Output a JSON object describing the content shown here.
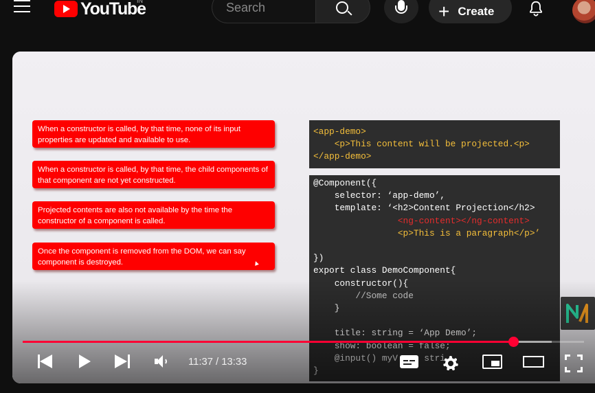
{
  "header": {
    "logo_text": "YouTube",
    "region": "IN",
    "search_placeholder": "Search",
    "create_label": "Create",
    "icons": [
      "menu-icon",
      "search-icon",
      "mic-icon",
      "plus-icon",
      "bell-icon"
    ]
  },
  "slide": {
    "cards": [
      "When a constructor is called, by that time, none of its input properties are updated and available to use.",
      "When a constructor is called, by that time, the child components of that component are not yet constructed.",
      "Projected contents are also not available by the time the constructor of a component is called.",
      "Once the component is removed from the DOM, we can say component is destroyed."
    ],
    "code_top": [
      "<app-demo>",
      "    <p>This content will be projected.<p>",
      "</app-demo>"
    ],
    "code_bottom": [
      "@Component({",
      "    selector: ‘app-demo’,",
      "    template: ‘<h2>Content Projection</h2>",
      "                <ng-content></ng-content>",
      "                <p>This is a paragraph</p>’",
      "",
      "})",
      "export class DemoComponent{",
      "    constructor(){",
      "        //Some code",
      "    }",
      "",
      "    title: string = ‘App Demo’;",
      "    show: boolean = false;",
      "    @input() myV     stri",
      "}"
    ],
    "colors": {
      "card_red": "#fe0000",
      "code_bg": "#2d2d2d",
      "tag_yellow": "#f5bf3a",
      "keyword_red": "#e52d2d",
      "type_blue": "#8fb7ff"
    }
  },
  "player": {
    "time_current": "11:37",
    "time_separator": " / ",
    "time_total": "13:33",
    "progress_fraction": 0.875,
    "buffered_fraction": 0.943,
    "progress_color": "#ff0033",
    "controls": [
      "previous-icon",
      "play-icon",
      "next-icon",
      "volume-icon",
      "subtitles-icon",
      "settings-icon",
      "miniplayer-icon",
      "theater-icon",
      "fullscreen-icon"
    ]
  }
}
